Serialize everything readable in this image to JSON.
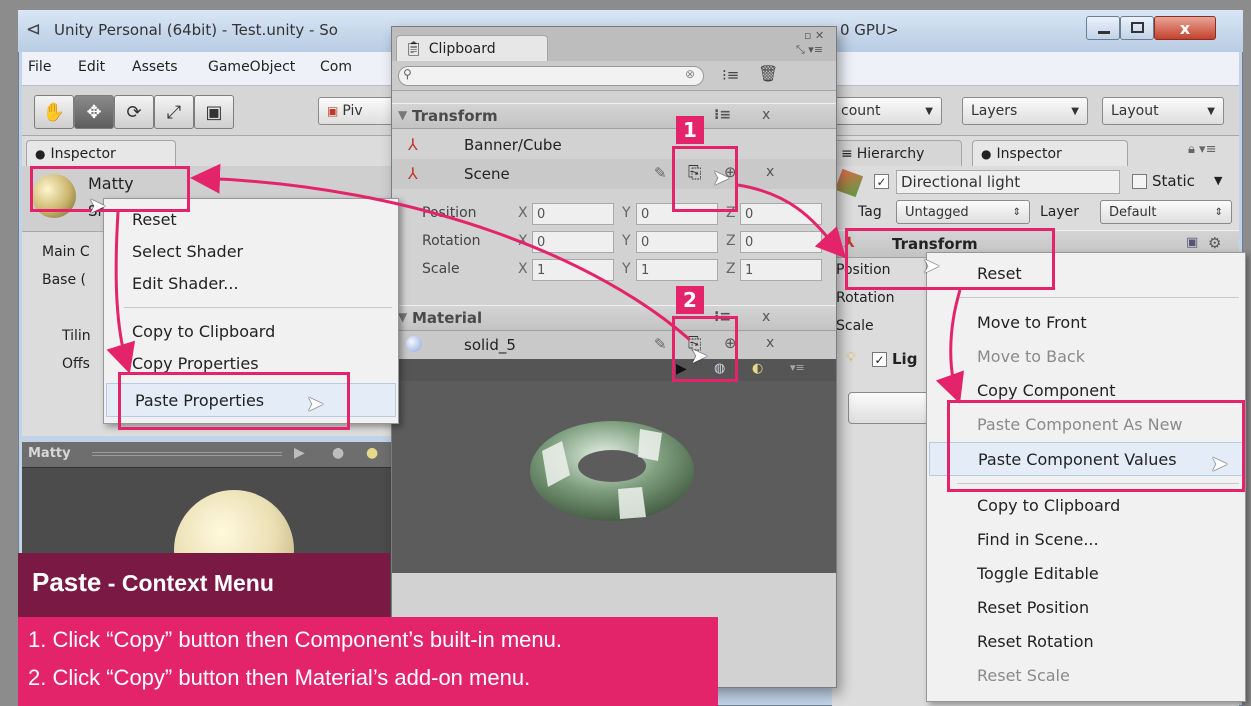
{
  "window": {
    "title": "Unity Personal (64bit) - Test.unity - So",
    "title_tail": "0 GPU>"
  },
  "menubar": [
    "File",
    "Edit",
    "Assets",
    "GameObject",
    "Com"
  ],
  "toolbar": {
    "pivot_label": "Piv",
    "account_label": "count",
    "layers_label": "Layers",
    "layout_label": "Layout"
  },
  "left_inspector": {
    "tab_label": "Inspector",
    "object_name": "Matty",
    "sub_label": "Sh",
    "rows": [
      "Main C",
      "Base (",
      "Tilin",
      "Offs"
    ],
    "preview_title": "Matty"
  },
  "left_menu": {
    "items": [
      {
        "label": "Reset",
        "disabled": false
      },
      {
        "label": "Select Shader",
        "disabled": false
      },
      {
        "label": "Edit Shader...",
        "disabled": false
      },
      {
        "label": "Copy to Clipboard",
        "disabled": false
      },
      {
        "label": "Copy Properties",
        "disabled": false
      },
      {
        "label": "Paste Properties",
        "disabled": false
      }
    ]
  },
  "clipboard": {
    "tab_label": "Clipboard",
    "transform_header": "Transform",
    "transform_items": [
      "Banner/Cube",
      "Scene"
    ],
    "fields": {
      "position": {
        "label": "Position",
        "x": "0",
        "y": "0",
        "z": "0"
      },
      "rotation": {
        "label": "Rotation",
        "x": "0",
        "y": "0",
        "z": "0"
      },
      "scale": {
        "label": "Scale",
        "x": "1",
        "y": "1",
        "z": "1"
      }
    },
    "axis_labels": {
      "x": "X",
      "y": "Y",
      "z": "Z"
    },
    "material_header": "Material",
    "material_item": "solid_5",
    "badge1": "1",
    "badge2": "2"
  },
  "right_inspector": {
    "hierarchy_tab": "Hierarchy",
    "inspector_tab": "Inspector",
    "object_name": "Directional light",
    "static_label": "Static",
    "tag_label": "Tag",
    "tag_value": "Untagged",
    "layer_label": "Layer",
    "layer_value": "Default",
    "transform_label": "Transform",
    "rows": [
      "Position",
      "Rotation",
      "Scale"
    ],
    "light_label": "Lig"
  },
  "right_menu": {
    "items": [
      {
        "label": "Reset",
        "disabled": false
      },
      {
        "label": "Move to Front",
        "disabled": false
      },
      {
        "label": "Move to Back",
        "disabled": true
      },
      {
        "label": "Copy Component",
        "disabled": false
      },
      {
        "label": "Paste Component As New",
        "disabled": true
      },
      {
        "label": "Paste Component Values",
        "disabled": false
      },
      {
        "label": "Copy to Clipboard",
        "disabled": false
      },
      {
        "label": "Find in Scene...",
        "disabled": false
      },
      {
        "label": "Toggle Editable",
        "disabled": false
      },
      {
        "label": "Reset Position",
        "disabled": false
      },
      {
        "label": "Reset Rotation",
        "disabled": false
      },
      {
        "label": "Reset Scale",
        "disabled": true
      }
    ]
  },
  "caption": {
    "title_bold": "Paste",
    "title_rest": " - Context Menu",
    "line1": "1. Click “Copy” button then Component’s built-in menu.",
    "line2": "2. Click “Copy” button then Material’s add-on menu."
  },
  "colors": {
    "accent": "#e3246b",
    "caption_dark": "#7a1a44",
    "win_frame": "#c2d3e8"
  }
}
